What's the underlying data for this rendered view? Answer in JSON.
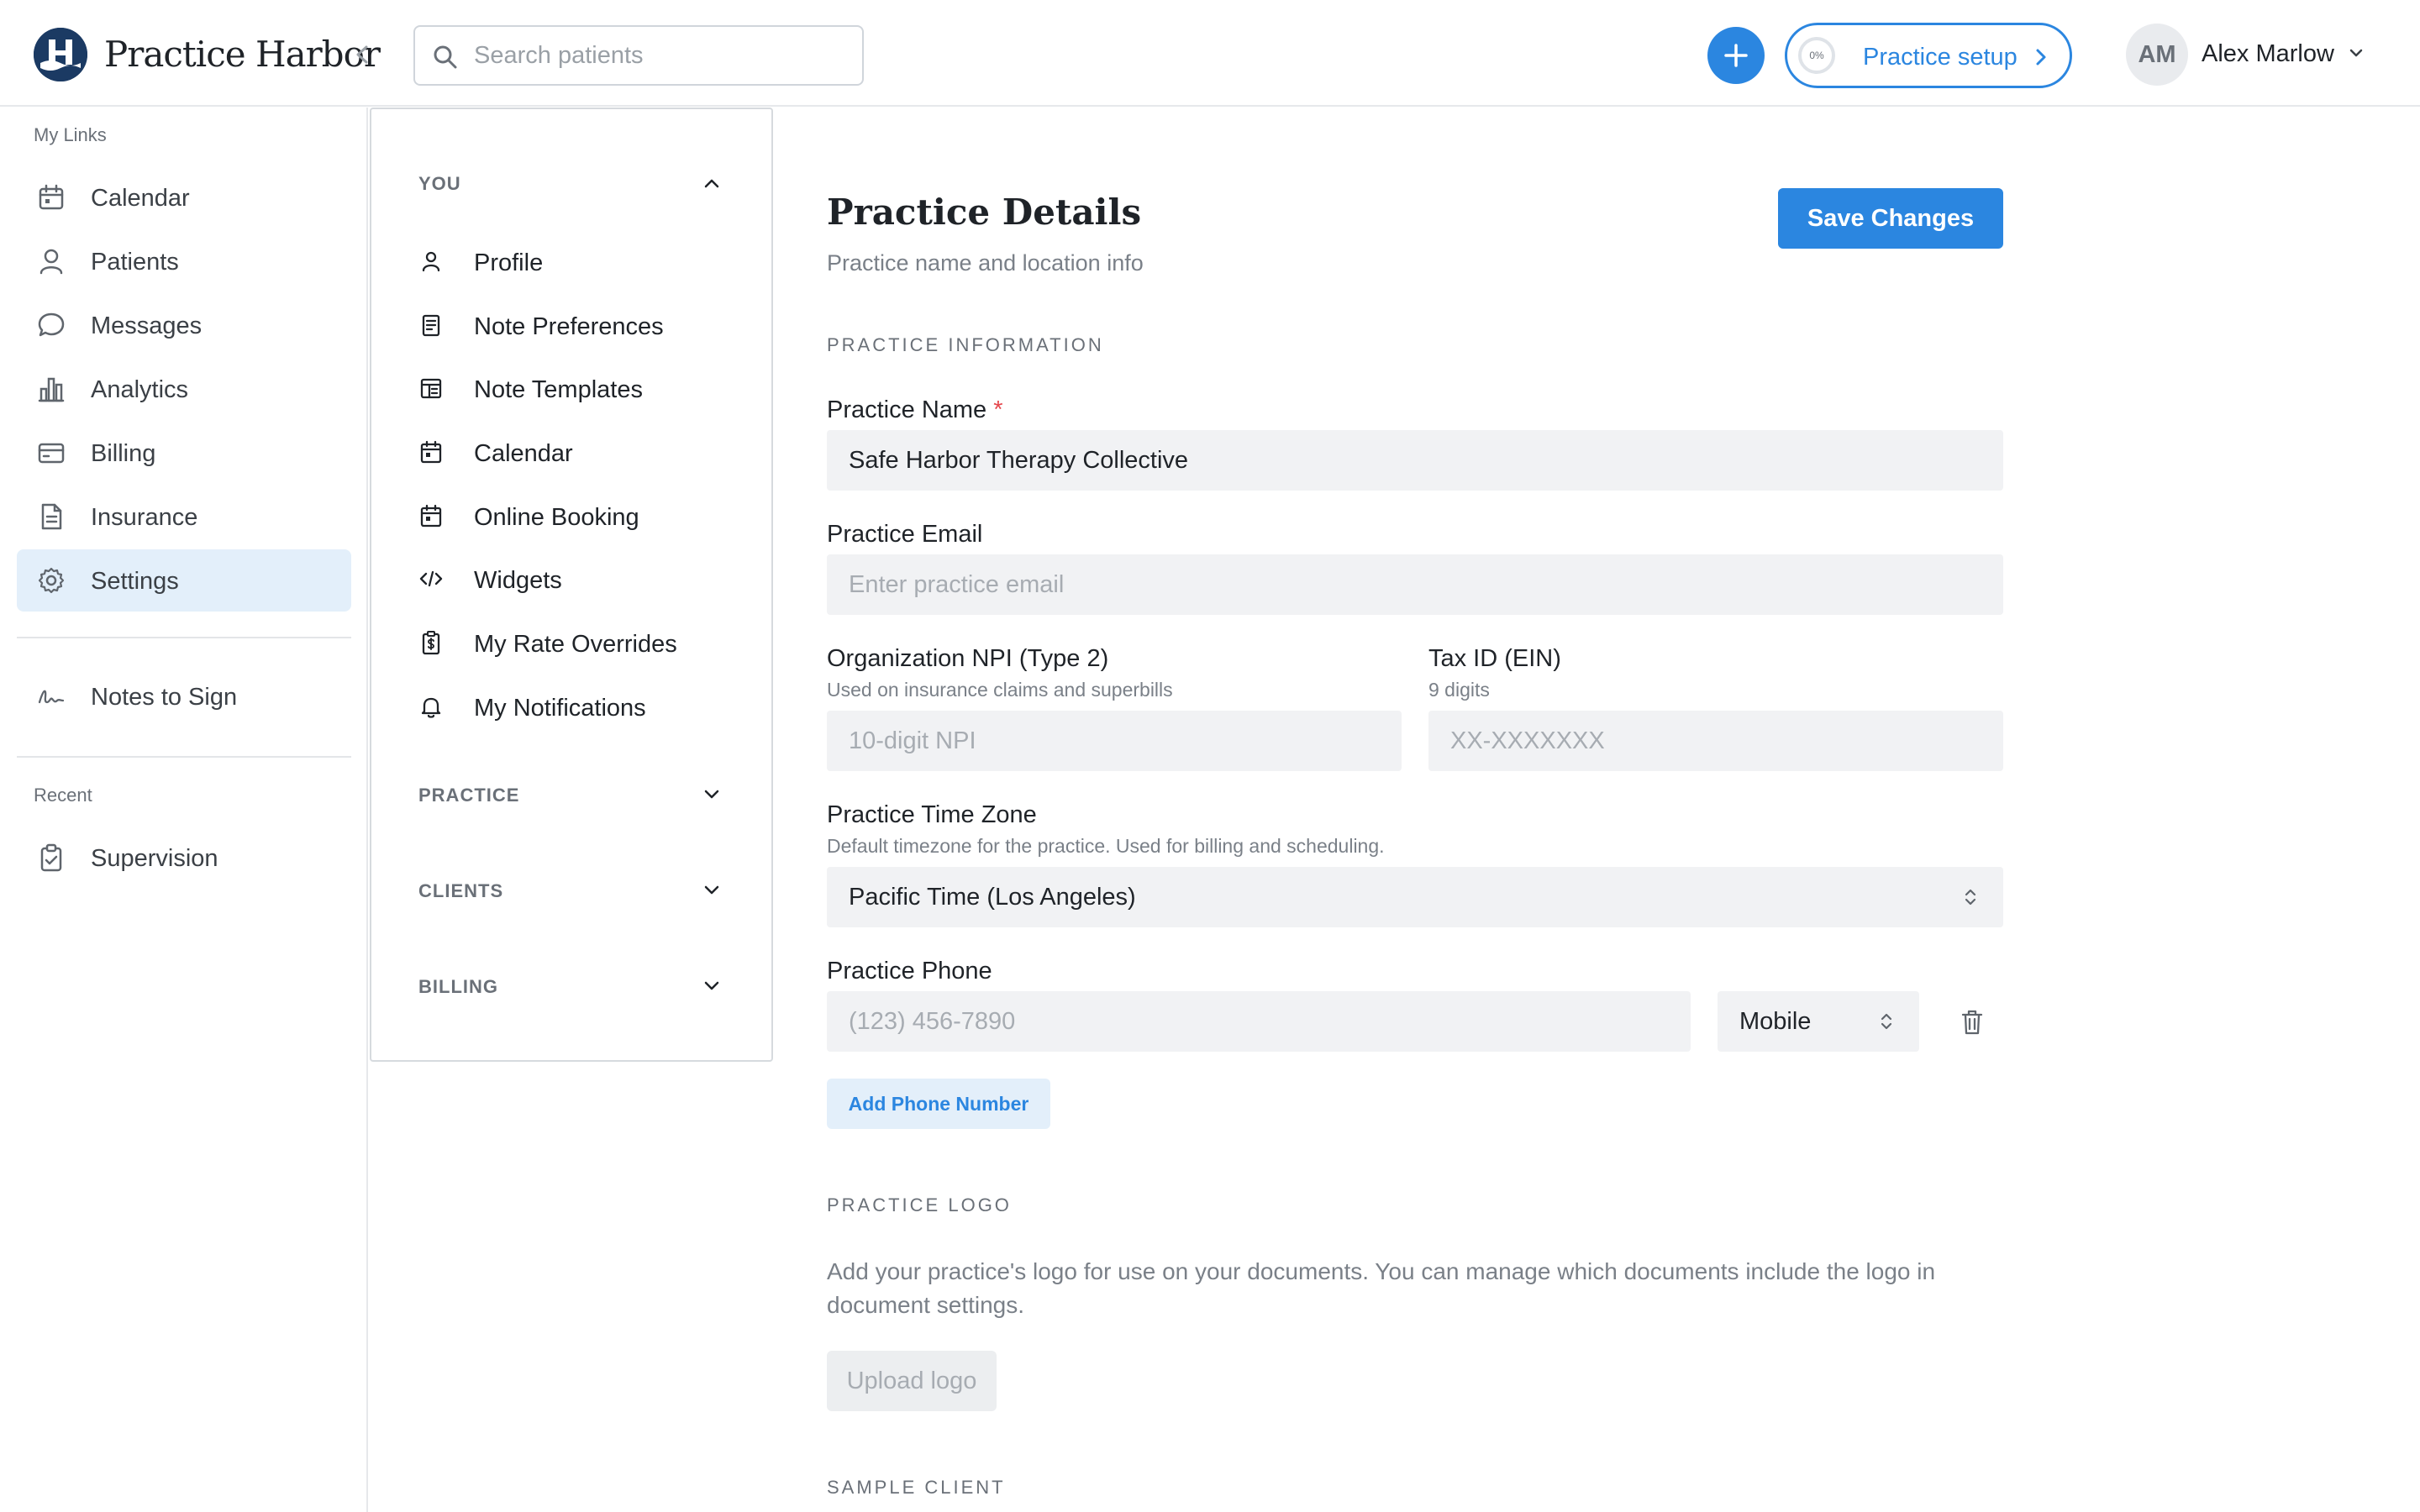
{
  "header": {
    "brand": "Practice Harbor",
    "search_placeholder": "Search patients",
    "setup_percent": "0%",
    "setup_label": "Practice setup",
    "avatar_initials": "AM",
    "user_name": "Alex Marlow"
  },
  "sidebar": {
    "my_links_heading": "My Links",
    "items": [
      {
        "label": "Calendar",
        "icon": "calendar-icon"
      },
      {
        "label": "Patients",
        "icon": "person-icon"
      },
      {
        "label": "Messages",
        "icon": "chat-bubble-icon"
      },
      {
        "label": "Analytics",
        "icon": "bar-chart-icon"
      },
      {
        "label": "Billing",
        "icon": "credit-card-icon"
      },
      {
        "label": "Insurance",
        "icon": "document-icon"
      },
      {
        "label": "Settings",
        "icon": "gear-icon",
        "active": true
      }
    ],
    "notes_to_sign": "Notes to Sign",
    "recent_heading": "Recent",
    "recent_items": [
      {
        "label": "Supervision",
        "icon": "clipboard-check-icon"
      }
    ]
  },
  "settings_menu": {
    "you_heading": "YOU",
    "you_items": [
      {
        "label": "Profile",
        "icon": "person-icon"
      },
      {
        "label": "Note Preferences",
        "icon": "note-icon"
      },
      {
        "label": "Note Templates",
        "icon": "template-icon"
      },
      {
        "label": "Calendar",
        "icon": "calendar-icon"
      },
      {
        "label": "Online Booking",
        "icon": "calendar-icon"
      },
      {
        "label": "Widgets",
        "icon": "code-icon"
      },
      {
        "label": "My Rate Overrides",
        "icon": "dollar-clipboard-icon"
      },
      {
        "label": "My Notifications",
        "icon": "bell-icon"
      }
    ],
    "practice_heading": "PRACTICE",
    "clients_heading": "CLIENTS",
    "billing_heading": "BILLING"
  },
  "main": {
    "title": "Practice Details",
    "subtitle": "Practice name and location info",
    "save_label": "Save Changes",
    "section_info": "PRACTICE INFORMATION",
    "practice_name_label": "Practice Name",
    "practice_name_required": "*",
    "practice_name_value": "Safe Harbor Therapy Collective",
    "practice_email_label": "Practice Email",
    "practice_email_placeholder": "Enter practice email",
    "npi_label": "Organization NPI (Type 2)",
    "npi_hint": "Used on insurance claims and superbills",
    "npi_placeholder": "10-digit NPI",
    "tax_label": "Tax ID (EIN)",
    "tax_hint": "9 digits",
    "tax_placeholder": "XX-XXXXXXX",
    "timezone_label": "Practice Time Zone",
    "timezone_hint": "Default timezone for the practice. Used for billing and scheduling.",
    "timezone_value": "Pacific Time (Los Angeles)",
    "phone_label": "Practice Phone",
    "phone_placeholder": "(123) 456-7890",
    "phone_type_value": "Mobile",
    "add_phone_label": "Add Phone Number",
    "section_logo": "PRACTICE LOGO",
    "logo_description": "Add your practice's logo for use on your documents. You can manage which documents include the logo in document settings.",
    "upload_logo_label": "Upload logo",
    "section_sample": "SAMPLE CLIENT"
  },
  "colors": {
    "accent": "#2b86e0",
    "brand_navy": "#1b3a63",
    "active_bg": "#e3effa",
    "field_bg": "#f1f2f4",
    "required": "#e5484d"
  }
}
